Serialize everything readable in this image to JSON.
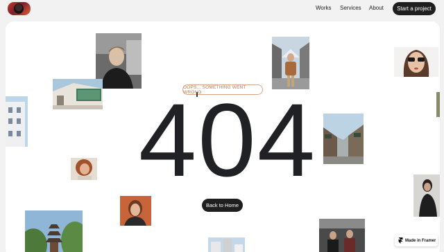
{
  "nav": {
    "links": [
      {
        "label": "Works"
      },
      {
        "label": "Services"
      },
      {
        "label": "About"
      }
    ],
    "cta_label": "Start a project"
  },
  "error": {
    "badge": "OOPS... SOMETHING WENT WRONG",
    "code": "404",
    "button": "Back to Home"
  },
  "badge": {
    "label": "Made in Framer",
    "icon": "framer-logo-icon"
  },
  "colors": {
    "accent": "#c9753f",
    "dark": "#1f1f1f",
    "background": "#f2f2f2"
  }
}
